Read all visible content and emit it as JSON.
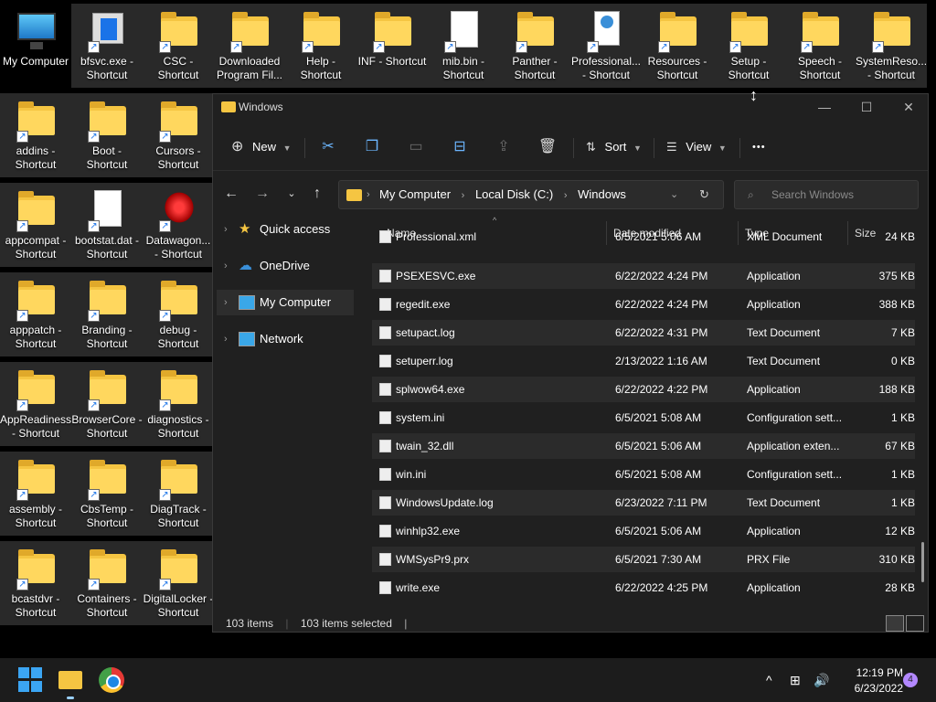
{
  "desktop": {
    "icons": [
      {
        "label": "My Computer",
        "type": "pc"
      },
      {
        "label": "bfsvc.exe - Shortcut",
        "type": "exe"
      },
      {
        "label": "CSC - Shortcut",
        "type": "folder"
      },
      {
        "label": "Downloaded Program Fil...",
        "type": "folder"
      },
      {
        "label": "Help - Shortcut",
        "type": "folder"
      },
      {
        "label": "INF - Shortcut",
        "type": "folder"
      },
      {
        "label": "mib.bin - Shortcut",
        "type": "file"
      },
      {
        "label": "Panther - Shortcut",
        "type": "folder"
      },
      {
        "label": "Professional... - Shortcut",
        "type": "web"
      },
      {
        "label": "Resources - Shortcut",
        "type": "folder"
      },
      {
        "label": "Setup - Shortcut",
        "type": "folder"
      },
      {
        "label": "Speech - Shortcut",
        "type": "folder"
      },
      {
        "label": "SystemReso... - Shortcut",
        "type": "folder"
      },
      {
        "label": "addins - Shortcut",
        "type": "folder"
      },
      {
        "label": "Boot - Shortcut",
        "type": "folder"
      },
      {
        "label": "Cursors - Shortcut",
        "type": "folder"
      },
      {
        "label": "appcompat - Shortcut",
        "type": "folder"
      },
      {
        "label": "bootstat.dat - Shortcut",
        "type": "file"
      },
      {
        "label": "Datawagon... - Shortcut",
        "type": "dw"
      },
      {
        "label": "apppatch - Shortcut",
        "type": "folder"
      },
      {
        "label": "Branding - Shortcut",
        "type": "folder"
      },
      {
        "label": "debug - Shortcut",
        "type": "folder"
      },
      {
        "label": "AppReadiness - Shortcut",
        "type": "folder"
      },
      {
        "label": "BrowserCore - Shortcut",
        "type": "folder"
      },
      {
        "label": "diagnostics - Shortcut",
        "type": "folder"
      },
      {
        "label": "assembly - Shortcut",
        "type": "folder"
      },
      {
        "label": "CbsTemp - Shortcut",
        "type": "folder"
      },
      {
        "label": "DiagTrack - Shortcut",
        "type": "folder"
      },
      {
        "label": "bcastdvr - Shortcut",
        "type": "folder"
      },
      {
        "label": "Containers - Shortcut",
        "type": "folder"
      },
      {
        "label": "DigitalLocker - Shortcut",
        "type": "folder"
      }
    ]
  },
  "window": {
    "title": "Windows",
    "controls": {
      "minimize": "—",
      "maximize": "☐",
      "close": "✕"
    }
  },
  "commandbar": {
    "new_label": "New",
    "sort_label": "Sort",
    "view_label": "View",
    "more_label": "•••"
  },
  "address": {
    "crumbs": [
      "My Computer",
      "Local Disk (C:)",
      "Windows"
    ],
    "search_placeholder": "Search Windows"
  },
  "navpane": {
    "items": [
      {
        "label": "Quick access",
        "icon": "star-icon"
      },
      {
        "label": "OneDrive",
        "icon": "cloud-icon"
      },
      {
        "label": "My Computer",
        "icon": "computer-icon",
        "active": true
      },
      {
        "label": "Network",
        "icon": "network-icon"
      }
    ]
  },
  "filelist": {
    "columns": {
      "name": "Name",
      "date": "Date modified",
      "type": "Type",
      "size": "Size"
    },
    "rows": [
      {
        "name": "Professional.xml",
        "date": "6/5/2021 5:06 AM",
        "type": "XML Document",
        "size": "24 KB"
      },
      {
        "name": "PSEXESVC.exe",
        "date": "6/22/2022 4:24 PM",
        "type": "Application",
        "size": "375 KB"
      },
      {
        "name": "regedit.exe",
        "date": "6/22/2022 4:24 PM",
        "type": "Application",
        "size": "388 KB"
      },
      {
        "name": "setupact.log",
        "date": "6/22/2022 4:31 PM",
        "type": "Text Document",
        "size": "7 KB"
      },
      {
        "name": "setuperr.log",
        "date": "2/13/2022 1:16 AM",
        "type": "Text Document",
        "size": "0 KB"
      },
      {
        "name": "splwow64.exe",
        "date": "6/22/2022 4:22 PM",
        "type": "Application",
        "size": "188 KB"
      },
      {
        "name": "system.ini",
        "date": "6/5/2021 5:08 AM",
        "type": "Configuration sett...",
        "size": "1 KB"
      },
      {
        "name": "twain_32.dll",
        "date": "6/5/2021 5:06 AM",
        "type": "Application exten...",
        "size": "67 KB"
      },
      {
        "name": "win.ini",
        "date": "6/5/2021 5:08 AM",
        "type": "Configuration sett...",
        "size": "1 KB"
      },
      {
        "name": "WindowsUpdate.log",
        "date": "6/23/2022 7:11 PM",
        "type": "Text Document",
        "size": "1 KB"
      },
      {
        "name": "winhlp32.exe",
        "date": "6/5/2021 5:06 AM",
        "type": "Application",
        "size": "12 KB"
      },
      {
        "name": "WMSysPr9.prx",
        "date": "6/5/2021 7:30 AM",
        "type": "PRX File",
        "size": "310 KB"
      },
      {
        "name": "write.exe",
        "date": "6/22/2022 4:25 PM",
        "type": "Application",
        "size": "28 KB"
      }
    ]
  },
  "status": {
    "count": "103 items",
    "selected": "103 items selected"
  },
  "taskbar": {
    "time": "12:19 PM",
    "date": "6/23/2022",
    "notifications": "4"
  }
}
